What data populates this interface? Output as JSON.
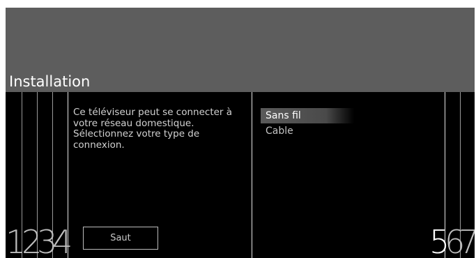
{
  "header": {
    "title": "Installation"
  },
  "steps": {
    "left": [
      "1",
      "2",
      "3",
      "4"
    ],
    "right": [
      "5",
      "6",
      "7"
    ],
    "current": "5"
  },
  "panel": {
    "description": "Ce téléviseur peut se connecter à votre réseau domestique. Sélectionnez votre type de connexion.",
    "skip_label": "Saut"
  },
  "options": [
    {
      "label": "Sans fil",
      "selected": true
    },
    {
      "label": "Cable",
      "selected": false
    }
  ],
  "colors": {
    "header_bg": "#5d5d5d",
    "screen_bg": "#000000",
    "selected_bg": "#5a5a5a"
  }
}
